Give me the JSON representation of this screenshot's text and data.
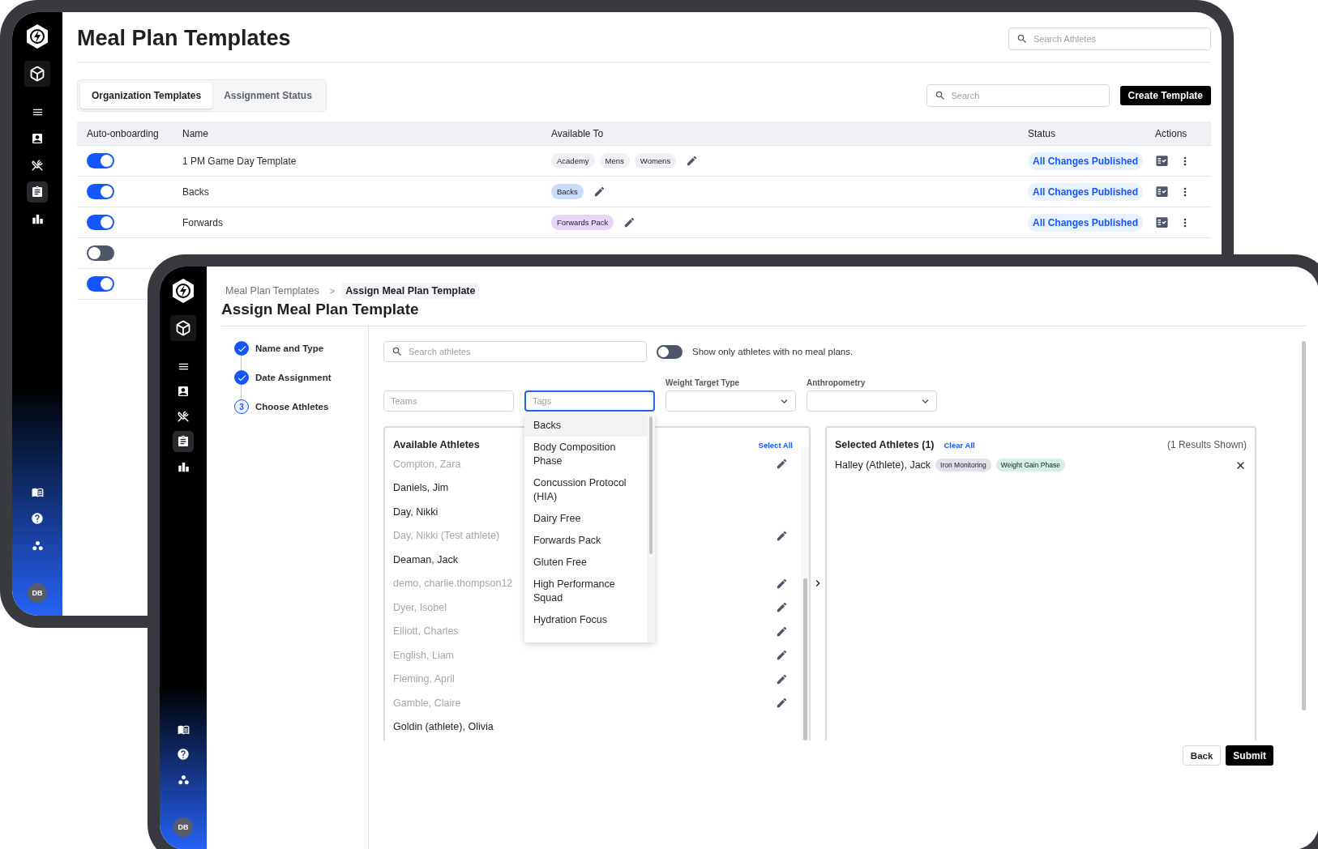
{
  "back_window": {
    "sidebar": {
      "nav": [
        {
          "kind": "menu",
          "selected": false
        },
        {
          "kind": "contacts",
          "selected": false
        },
        {
          "kind": "meals",
          "selected": false
        },
        {
          "kind": "clipboard",
          "selected": true
        },
        {
          "kind": "chart",
          "selected": false
        }
      ],
      "footer": [
        {
          "kind": "book"
        },
        {
          "kind": "help"
        },
        {
          "kind": "apps"
        }
      ],
      "avatar": "DB"
    },
    "title": "Meal Plan Templates",
    "search": {
      "placeholder": "Search Athletes"
    },
    "tabs": [
      {
        "label": "Organization Templates",
        "selected": true
      },
      {
        "label": "Assignment Status",
        "selected": false
      }
    ],
    "table_search": {
      "placeholder": "Search"
    },
    "create_button": "Create Template",
    "table": {
      "columns": [
        "Auto-onboarding",
        "Name",
        "Available To",
        "Status",
        "Actions"
      ],
      "rows": [
        {
          "auto_onboarding": true,
          "name": "1 PM Game Day Template",
          "available_to": [
            {
              "label": "Academy",
              "color": "#eef0f4"
            },
            {
              "label": "Mens",
              "color": "#eef0f4"
            },
            {
              "label": "Womens",
              "color": "#eef0f4"
            }
          ],
          "status": "All Changes Published"
        },
        {
          "auto_onboarding": true,
          "name": "Backs",
          "available_to": [
            {
              "label": "Backs",
              "color": "#c8dbfb"
            }
          ],
          "status": "All Changes Published"
        },
        {
          "auto_onboarding": true,
          "name": "Forwards",
          "available_to": [
            {
              "label": "Forwards Pack",
              "color": "#e6d5f7"
            }
          ],
          "status": "All Changes Published"
        },
        {
          "auto_onboarding": false
        },
        {
          "auto_onboarding": true
        }
      ]
    }
  },
  "front_window": {
    "sidebar": {
      "nav": [
        {
          "kind": "menu",
          "selected": false
        },
        {
          "kind": "contacts",
          "selected": false
        },
        {
          "kind": "meals",
          "selected": false
        },
        {
          "kind": "clipboard",
          "selected": true
        },
        {
          "kind": "chart",
          "selected": false
        }
      ],
      "footer": [
        {
          "kind": "book"
        },
        {
          "kind": "help"
        },
        {
          "kind": "apps"
        }
      ],
      "avatar": "DB"
    },
    "breadcrumb": [
      {
        "label": "Meal Plan Templates",
        "current": false
      },
      {
        "label": "Assign Meal Plan Template",
        "current": true
      }
    ],
    "breadcrumb_separator": ">",
    "title": "Assign Meal Plan Template",
    "steps": [
      {
        "label": "Name and Type",
        "done": true
      },
      {
        "label": "Date Assignment",
        "done": true
      },
      {
        "label": "Choose Athletes",
        "done": false,
        "number": "3"
      }
    ],
    "athlete_search": {
      "placeholder": "Search athletes"
    },
    "no_meal_plan_toggle": {
      "on": false,
      "label": "Show only athletes with no meal plans."
    },
    "filters": [
      {
        "kind": "text",
        "placeholder": "Teams",
        "focused": false
      },
      {
        "kind": "text",
        "placeholder": "Tags",
        "focused": true
      },
      {
        "kind": "select",
        "label": "Weight Target Type"
      },
      {
        "kind": "select",
        "label": "Anthropometry"
      }
    ],
    "tag_dropdown": {
      "options": [
        {
          "label": "Backs",
          "selected": true
        },
        {
          "label": "Body Composition Phase",
          "selected": false
        },
        {
          "label": "Concussion Protocol (HIA)",
          "selected": false
        },
        {
          "label": "Dairy Free",
          "selected": false
        },
        {
          "label": "Forwards Pack",
          "selected": false
        },
        {
          "label": "Gluten Free",
          "selected": false
        },
        {
          "label": "High Performance Squad",
          "selected": false
        },
        {
          "label": "Hydration Focus",
          "selected": false
        }
      ]
    },
    "available": {
      "title": "Available Athletes",
      "select_all": "Select All",
      "athletes": [
        {
          "name": "Compton, Zara",
          "disabled": true
        },
        {
          "name": "Daniels, Jim",
          "disabled": false
        },
        {
          "name": "Day, Nikki",
          "disabled": false
        },
        {
          "name": "Day, Nikki (Test athlete)",
          "disabled": true
        },
        {
          "name": "Deaman, Jack",
          "disabled": false
        },
        {
          "name": "demo, charlie.thompson12",
          "disabled": true
        },
        {
          "name": "Dyer, Isobel",
          "disabled": true
        },
        {
          "name": "Elliott, Charles",
          "disabled": true
        },
        {
          "name": "English, Liam",
          "disabled": true
        },
        {
          "name": "Fleming, April",
          "disabled": true
        },
        {
          "name": "Gamble, Claire",
          "disabled": true
        },
        {
          "name": "Goldin (athlete), Olivia",
          "disabled": false
        }
      ]
    },
    "selected": {
      "title": "Selected Athletes (1)",
      "clear_all": "Clear All",
      "results": "(1 Results Shown)",
      "athletes": [
        {
          "name": "Halley (Athlete), Jack",
          "tags": [
            {
              "label": "Iron Monitoring",
              "color": "#dfe1eb"
            },
            {
              "label": "Weight Gain Phase",
              "color": "#d3efe6"
            }
          ]
        }
      ]
    },
    "buttons": [
      {
        "label": "Back",
        "kind": "secondary"
      },
      {
        "label": "Submit",
        "kind": "primary"
      }
    ]
  }
}
